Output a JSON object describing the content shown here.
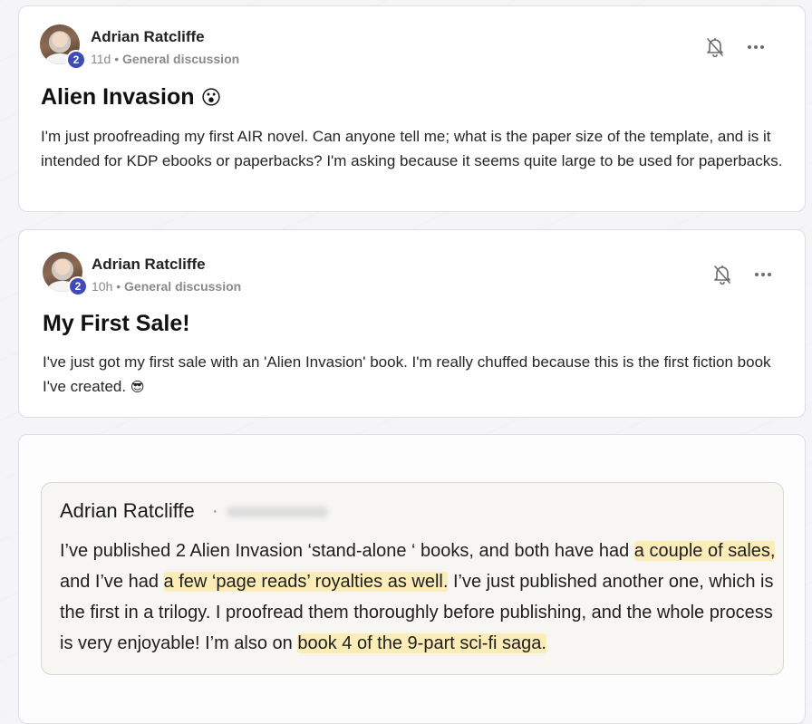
{
  "posts": [
    {
      "author": "Adrian Ratcliffe",
      "badge": "2",
      "age": "11d",
      "separator": "•",
      "category": "General discussion",
      "title": "Alien Invasion",
      "title_emoji": "😮",
      "body": "I'm just proofreading my first AIR novel. Can anyone tell me; what is the paper size of the template, and is it intended for KDP ebooks or paperbacks? I'm asking because it seems quite large to be used for paperbacks."
    },
    {
      "author": "Adrian Ratcliffe",
      "badge": "2",
      "age": "10h",
      "separator": "•",
      "category": "General discussion",
      "title": "My First Sale!",
      "body": "I've just got my first sale with an 'Alien Invasion' book. I'm really chuffed because this is the first fiction book I've created.",
      "body_emoji": "😎"
    }
  ],
  "quote": {
    "author": "Adrian Ratcliffe",
    "dot": "·",
    "text_1": "I’ve published 2 Alien Invasion ‘stand-alone ‘ books, and both have had ",
    "hl_1": "a couple of sales,",
    "text_2": "and I’ve had ",
    "hl_2": "a few ‘page reads’ royalties as well.",
    "text_3": " I’ve just published another one, which is the first in a trilogy. I proofread them thoroughly before publishing, and the whole process is very enjoyable! I’m also on ",
    "hl_3": "book 4 of the 9-part sci-fi saga."
  },
  "icons": {
    "notify": "bell-off-icon",
    "menu": "more-horizontal-icon"
  },
  "colors": {
    "badge": "#3f4bb8",
    "highlight": "#fbecb8",
    "meta": "#8a8a8f"
  }
}
